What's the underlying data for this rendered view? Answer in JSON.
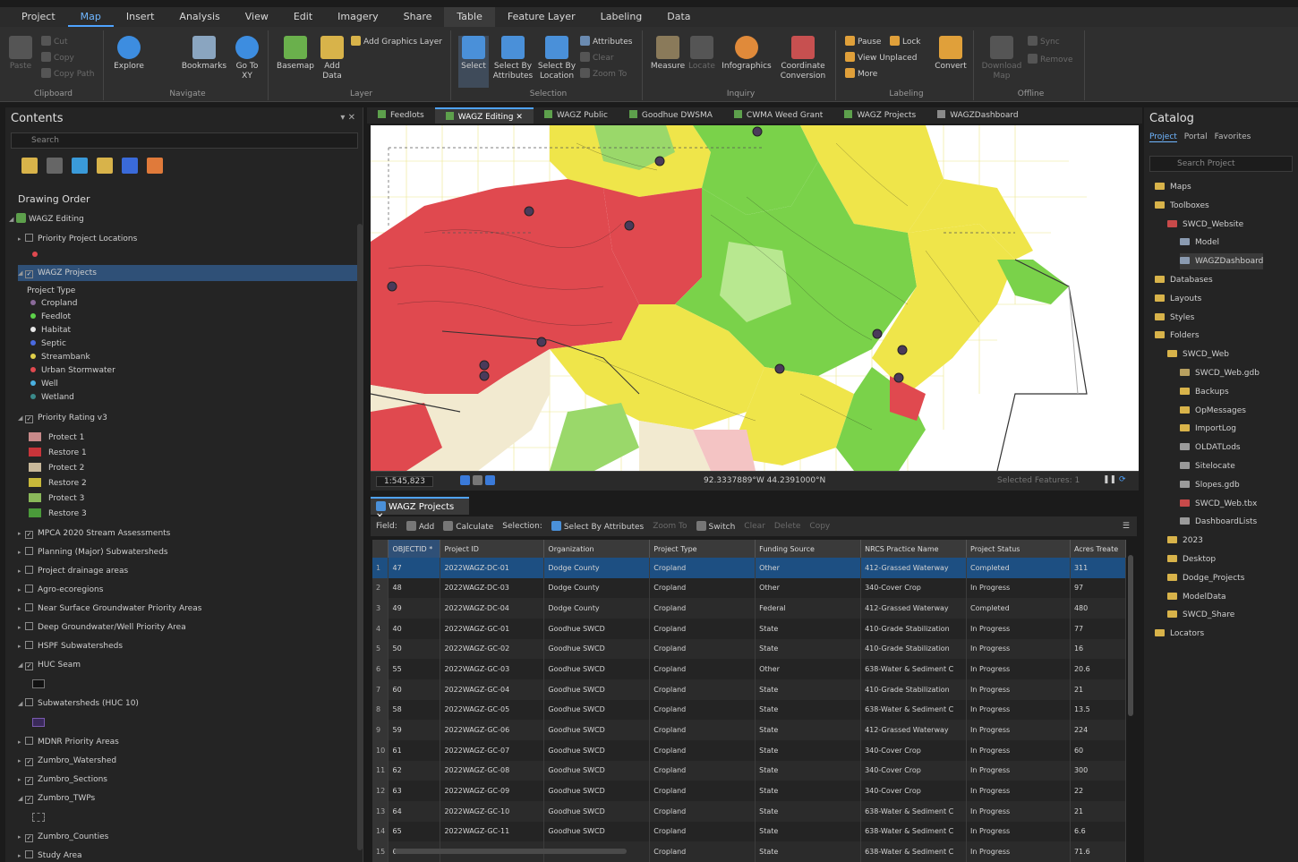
{
  "menu": [
    "Project",
    "Map",
    "Insert",
    "Analysis",
    "View",
    "Edit",
    "Imagery",
    "Share",
    "Table",
    "Feature Layer",
    "Labeling",
    "Data"
  ],
  "ribbon": {
    "clipboard": {
      "paste": "Paste",
      "cut": "Cut",
      "copy": "Copy",
      "copy_path": "Copy Path",
      "label": "Clipboard"
    },
    "navigate": {
      "explore": "Explore",
      "bookmarks": "Bookmarks",
      "goto": "Go To XY",
      "label": "Navigate"
    },
    "layer": {
      "basemap": "Basemap",
      "add_data": "Add Data",
      "add_graphics": "Add Graphics Layer",
      "label": "Layer"
    },
    "selection": {
      "select": "Select",
      "by_attr": "Select By Attributes",
      "by_loc": "Select By Location",
      "attributes": "Attributes",
      "clear": "Clear",
      "zoom_to": "Zoom To",
      "label": "Selection"
    },
    "inquiry": {
      "measure": "Measure",
      "locate": "Locate",
      "infographics": "Infographics",
      "coord": "Coordinate Conversion",
      "label": "Inquiry"
    },
    "labeling": {
      "pause": "Pause",
      "lock": "Lock",
      "view_unplaced": "View Unplaced",
      "more": "More",
      "convert": "Convert",
      "label": "Labeling"
    },
    "offline": {
      "download": "Download Map",
      "sync": "Sync",
      "remove": "Remove",
      "label": "Offline"
    }
  },
  "contents": {
    "title": "Contents",
    "search_placeholder": "Search",
    "drawing_order": "Drawing Order",
    "map_name": "WAGZ Editing",
    "layers": {
      "priority_locations": "Priority Project Locations",
      "wagz_projects": "WAGZ Projects",
      "project_type": "Project Type",
      "types": [
        "Cropland",
        "Feedlot",
        "Habitat",
        "Septic",
        "Streambank",
        "Urban Stormwater",
        "Well",
        "Wetland"
      ],
      "priority_rating": "Priority Rating v3",
      "ratings": [
        "Protect 1",
        "Restore 1",
        "Protect 2",
        "Restore 2",
        "Protect 3",
        "Restore 3"
      ],
      "others": [
        "MPCA 2020 Stream Assessments",
        "Planning (Major) Subwatersheds",
        "Project drainage areas",
        "Agro-ecoregions",
        "Near Surface Groundwater Priority Areas",
        "Deep Groundwater/Well Priority Area",
        "HSPF Subwatersheds"
      ],
      "huc_seam": "HUC Seam",
      "subwatersheds": "Subwatersheds (HUC 10)",
      "tail": [
        "MDNR Priority Areas",
        "Zumbro_Watershed",
        "Zumbro_Sections",
        "Zumbro_TWPs",
        "Zumbro_Counties",
        "Study Area"
      ]
    }
  },
  "map_tabs": [
    "Feedlots",
    "WAGZ Editing",
    "WAGZ Public",
    "Goodhue DWSMA",
    "CWMA Weed Grant",
    "WAGZ Projects",
    "WAGZDashboard"
  ],
  "map_status": {
    "scale": "1:545,823",
    "coords": "92.3337889°W 44.2391000°N",
    "selected": "Selected Features: 1"
  },
  "table": {
    "tab": "WAGZ Projects",
    "toolbar": {
      "field": "Field:",
      "add": "Add",
      "calculate": "Calculate",
      "selection": "Selection:",
      "select_by_attr": "Select By Attributes",
      "zoom_to": "Zoom To",
      "switch": "Switch",
      "clear": "Clear",
      "delete": "Delete",
      "copy": "Copy"
    },
    "columns": [
      "OBJECTID *",
      "Project ID",
      "Organization",
      "Project Type",
      "Funding Source",
      "NRCS Practice Name",
      "Project Status",
      "Acres Treate"
    ],
    "rows": [
      [
        "1",
        "47",
        "2022WAGZ-DC-01",
        "Dodge County",
        "Cropland",
        "Other",
        "412-Grassed Waterway",
        "Completed",
        "311"
      ],
      [
        "2",
        "48",
        "2022WAGZ-DC-03",
        "Dodge County",
        "Cropland",
        "Other",
        "340-Cover Crop",
        "In Progress",
        "97"
      ],
      [
        "3",
        "49",
        "2022WAGZ-DC-04",
        "Dodge County",
        "Cropland",
        "Federal",
        "412-Grassed Waterway",
        "Completed",
        "480"
      ],
      [
        "4",
        "40",
        "2022WAGZ-GC-01",
        "Goodhue SWCD",
        "Cropland",
        "State",
        "410-Grade Stabilization",
        "In Progress",
        "77"
      ],
      [
        "5",
        "50",
        "2022WAGZ-GC-02",
        "Goodhue SWCD",
        "Cropland",
        "State",
        "410-Grade Stabilization",
        "In Progress",
        "16"
      ],
      [
        "6",
        "55",
        "2022WAGZ-GC-03",
        "Goodhue SWCD",
        "Cropland",
        "Other",
        "638-Water & Sediment C",
        "In Progress",
        "20.6"
      ],
      [
        "7",
        "60",
        "2022WAGZ-GC-04",
        "Goodhue SWCD",
        "Cropland",
        "State",
        "410-Grade Stabilization",
        "In Progress",
        "21"
      ],
      [
        "8",
        "58",
        "2022WAGZ-GC-05",
        "Goodhue SWCD",
        "Cropland",
        "State",
        "638-Water & Sediment C",
        "In Progress",
        "13.5"
      ],
      [
        "9",
        "59",
        "2022WAGZ-GC-06",
        "Goodhue SWCD",
        "Cropland",
        "State",
        "412-Grassed Waterway",
        "In Progress",
        "224"
      ],
      [
        "10",
        "61",
        "2022WAGZ-GC-07",
        "Goodhue SWCD",
        "Cropland",
        "State",
        "340-Cover Crop",
        "In Progress",
        "60"
      ],
      [
        "11",
        "62",
        "2022WAGZ-GC-08",
        "Goodhue SWCD",
        "Cropland",
        "State",
        "340-Cover Crop",
        "In Progress",
        "300"
      ],
      [
        "12",
        "63",
        "2022WAGZ-GC-09",
        "Goodhue SWCD",
        "Cropland",
        "State",
        "340-Cover Crop",
        "In Progress",
        "22"
      ],
      [
        "13",
        "64",
        "2022WAGZ-GC-10",
        "Goodhue SWCD",
        "Cropland",
        "State",
        "638-Water & Sediment C",
        "In Progress",
        "21"
      ],
      [
        "14",
        "65",
        "2022WAGZ-GC-11",
        "Goodhue SWCD",
        "Cropland",
        "State",
        "638-Water & Sediment C",
        "In Progress",
        "6.6"
      ],
      [
        "15",
        "66",
        "2022WAGZ-GC-12",
        "Goodhue SWCD",
        "Cropland",
        "State",
        "638-Water & Sediment C",
        "In Progress",
        "71.6"
      ]
    ]
  },
  "catalog": {
    "title": "Catalog",
    "tabs": [
      "Project",
      "Portal",
      "Favorites"
    ],
    "search_placeholder": "Search Project",
    "items": [
      "Maps",
      "Toolboxes",
      "SWCD_Website",
      "Model",
      "WAGZDashboard",
      "Databases",
      "Layouts",
      "Styles",
      "Folders",
      "SWCD_Web",
      "SWCD_Web.gdb",
      "Backups",
      "OpMessages",
      "ImportLog",
      "OLDATLods",
      "Sitelocate",
      "Slopes.gdb",
      "SWCD_Web.tbx",
      "DashboardLists",
      "2023",
      "Desktop",
      "Dodge_Projects",
      "ModelData",
      "SWCD_Share",
      "Locators"
    ]
  },
  "colors": {
    "accent": "#4fa3ff",
    "selected_row": "#1d4f82",
    "restore": "#e0494f",
    "protect_green": "#7ad24a",
    "yellow": "#efe54a"
  }
}
